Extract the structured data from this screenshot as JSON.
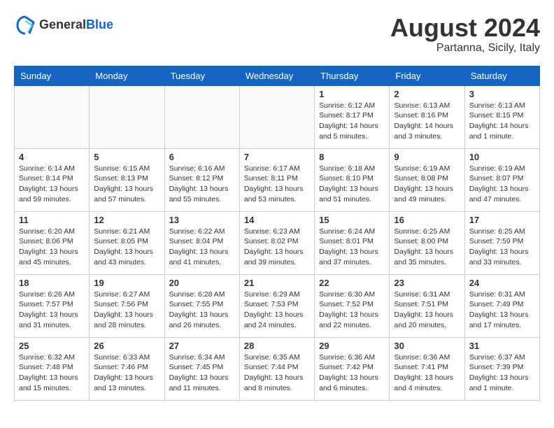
{
  "header": {
    "logo_general": "General",
    "logo_blue": "Blue",
    "month_title": "August 2024",
    "location": "Partanna, Sicily, Italy"
  },
  "days_of_week": [
    "Sunday",
    "Monday",
    "Tuesday",
    "Wednesday",
    "Thursday",
    "Friday",
    "Saturday"
  ],
  "weeks": [
    [
      {
        "day": "",
        "info": ""
      },
      {
        "day": "",
        "info": ""
      },
      {
        "day": "",
        "info": ""
      },
      {
        "day": "",
        "info": ""
      },
      {
        "day": "1",
        "info": "Sunrise: 6:12 AM\nSunset: 8:17 PM\nDaylight: 14 hours\nand 5 minutes."
      },
      {
        "day": "2",
        "info": "Sunrise: 6:13 AM\nSunset: 8:16 PM\nDaylight: 14 hours\nand 3 minutes."
      },
      {
        "day": "3",
        "info": "Sunrise: 6:13 AM\nSunset: 8:15 PM\nDaylight: 14 hours\nand 1 minute."
      }
    ],
    [
      {
        "day": "4",
        "info": "Sunrise: 6:14 AM\nSunset: 8:14 PM\nDaylight: 13 hours\nand 59 minutes."
      },
      {
        "day": "5",
        "info": "Sunrise: 6:15 AM\nSunset: 8:13 PM\nDaylight: 13 hours\nand 57 minutes."
      },
      {
        "day": "6",
        "info": "Sunrise: 6:16 AM\nSunset: 8:12 PM\nDaylight: 13 hours\nand 55 minutes."
      },
      {
        "day": "7",
        "info": "Sunrise: 6:17 AM\nSunset: 8:11 PM\nDaylight: 13 hours\nand 53 minutes."
      },
      {
        "day": "8",
        "info": "Sunrise: 6:18 AM\nSunset: 8:10 PM\nDaylight: 13 hours\nand 51 minutes."
      },
      {
        "day": "9",
        "info": "Sunrise: 6:19 AM\nSunset: 8:08 PM\nDaylight: 13 hours\nand 49 minutes."
      },
      {
        "day": "10",
        "info": "Sunrise: 6:19 AM\nSunset: 8:07 PM\nDaylight: 13 hours\nand 47 minutes."
      }
    ],
    [
      {
        "day": "11",
        "info": "Sunrise: 6:20 AM\nSunset: 8:06 PM\nDaylight: 13 hours\nand 45 minutes."
      },
      {
        "day": "12",
        "info": "Sunrise: 6:21 AM\nSunset: 8:05 PM\nDaylight: 13 hours\nand 43 minutes."
      },
      {
        "day": "13",
        "info": "Sunrise: 6:22 AM\nSunset: 8:04 PM\nDaylight: 13 hours\nand 41 minutes."
      },
      {
        "day": "14",
        "info": "Sunrise: 6:23 AM\nSunset: 8:02 PM\nDaylight: 13 hours\nand 39 minutes."
      },
      {
        "day": "15",
        "info": "Sunrise: 6:24 AM\nSunset: 8:01 PM\nDaylight: 13 hours\nand 37 minutes."
      },
      {
        "day": "16",
        "info": "Sunrise: 6:25 AM\nSunset: 8:00 PM\nDaylight: 13 hours\nand 35 minutes."
      },
      {
        "day": "17",
        "info": "Sunrise: 6:25 AM\nSunset: 7:59 PM\nDaylight: 13 hours\nand 33 minutes."
      }
    ],
    [
      {
        "day": "18",
        "info": "Sunrise: 6:26 AM\nSunset: 7:57 PM\nDaylight: 13 hours\nand 31 minutes."
      },
      {
        "day": "19",
        "info": "Sunrise: 6:27 AM\nSunset: 7:56 PM\nDaylight: 13 hours\nand 28 minutes."
      },
      {
        "day": "20",
        "info": "Sunrise: 6:28 AM\nSunset: 7:55 PM\nDaylight: 13 hours\nand 26 minutes."
      },
      {
        "day": "21",
        "info": "Sunrise: 6:29 AM\nSunset: 7:53 PM\nDaylight: 13 hours\nand 24 minutes."
      },
      {
        "day": "22",
        "info": "Sunrise: 6:30 AM\nSunset: 7:52 PM\nDaylight: 13 hours\nand 22 minutes."
      },
      {
        "day": "23",
        "info": "Sunrise: 6:31 AM\nSunset: 7:51 PM\nDaylight: 13 hours\nand 20 minutes."
      },
      {
        "day": "24",
        "info": "Sunrise: 6:31 AM\nSunset: 7:49 PM\nDaylight: 13 hours\nand 17 minutes."
      }
    ],
    [
      {
        "day": "25",
        "info": "Sunrise: 6:32 AM\nSunset: 7:48 PM\nDaylight: 13 hours\nand 15 minutes."
      },
      {
        "day": "26",
        "info": "Sunrise: 6:33 AM\nSunset: 7:46 PM\nDaylight: 13 hours\nand 13 minutes."
      },
      {
        "day": "27",
        "info": "Sunrise: 6:34 AM\nSunset: 7:45 PM\nDaylight: 13 hours\nand 11 minutes."
      },
      {
        "day": "28",
        "info": "Sunrise: 6:35 AM\nSunset: 7:44 PM\nDaylight: 13 hours\nand 8 minutes."
      },
      {
        "day": "29",
        "info": "Sunrise: 6:36 AM\nSunset: 7:42 PM\nDaylight: 13 hours\nand 6 minutes."
      },
      {
        "day": "30",
        "info": "Sunrise: 6:36 AM\nSunset: 7:41 PM\nDaylight: 13 hours\nand 4 minutes."
      },
      {
        "day": "31",
        "info": "Sunrise: 6:37 AM\nSunset: 7:39 PM\nDaylight: 13 hours\nand 1 minute."
      }
    ]
  ]
}
